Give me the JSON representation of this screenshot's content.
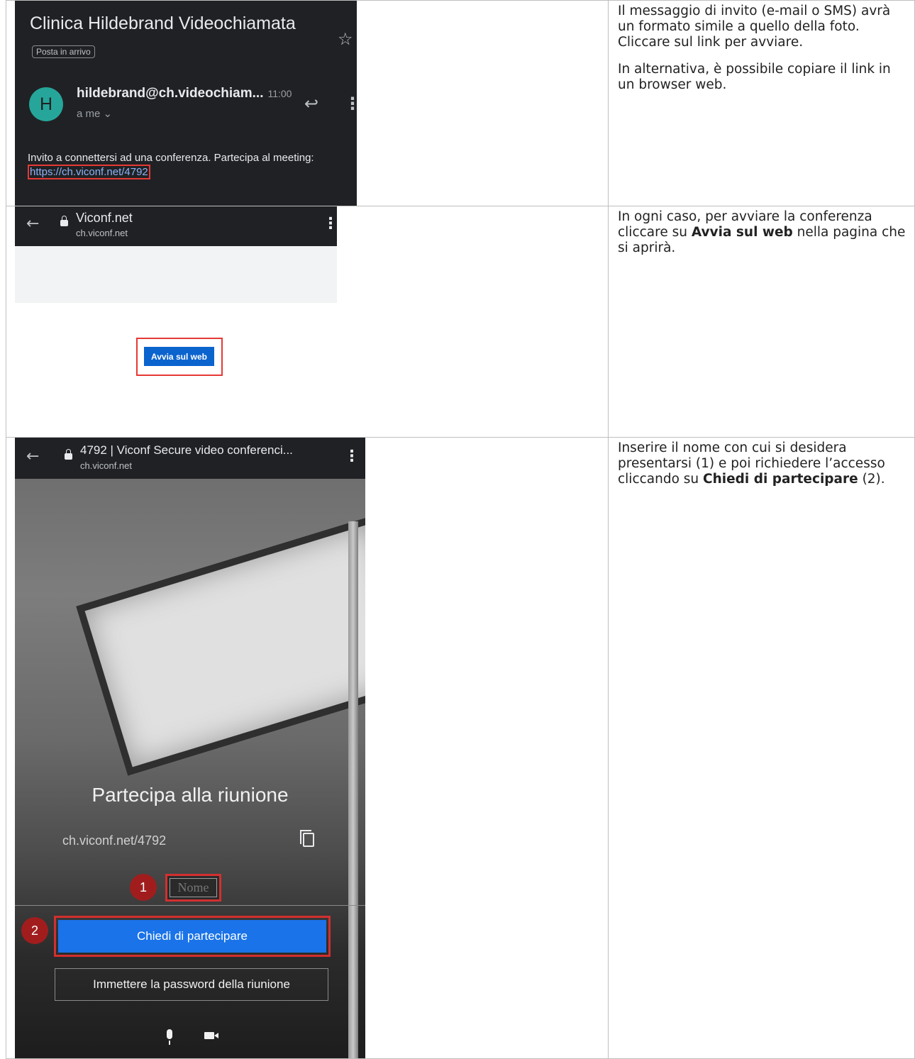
{
  "rows": [
    {
      "screenshot": {
        "subject": "Clinica Hildebrand Videochiamata",
        "label": "Posta in arrivo",
        "avatar_letter": "H",
        "sender": "hildebrand@ch.videochiam...",
        "time": "11:00",
        "recipient": "a me",
        "body": "Invito a connettersi ad una conferenza. Partecipa al meeting:",
        "link": "https://ch.viconf.net/4792"
      },
      "text": {
        "p1": "Il messaggio di invito (e-mail o SMS) avrà un formato simile a quello della foto. Cliccare sul link per avviare.",
        "p2": "In alternativa, è possibile copiare il link in un browser web."
      }
    },
    {
      "screenshot": {
        "page_title": "Viconf.net",
        "page_url": "ch.viconf.net",
        "button": "Avvia sul web"
      },
      "text": {
        "pre": "In ogni caso, per avviare la conferenza cliccare su ",
        "bold": "Avvia sul web",
        "post": " nella pagina che si aprirà."
      }
    },
    {
      "screenshot": {
        "page_title": "4792 | Viconf Secure video conferenci...",
        "page_url": "ch.viconf.net",
        "heading": "Partecipa alla riunione",
        "meeting_url": "ch.viconf.net/4792",
        "badge1": "1",
        "name_placeholder": "Nome",
        "badge2": "2",
        "join_button": "Chiedi di partecipare",
        "password_button": "Immettere la password della riunione"
      },
      "text": {
        "pre": "Inserire il nome con cui si desidera presentarsi (1) e poi richiedere l’accesso cliccando su ",
        "bold": "Chiedi di partecipare",
        "post": " (2)."
      }
    }
  ]
}
